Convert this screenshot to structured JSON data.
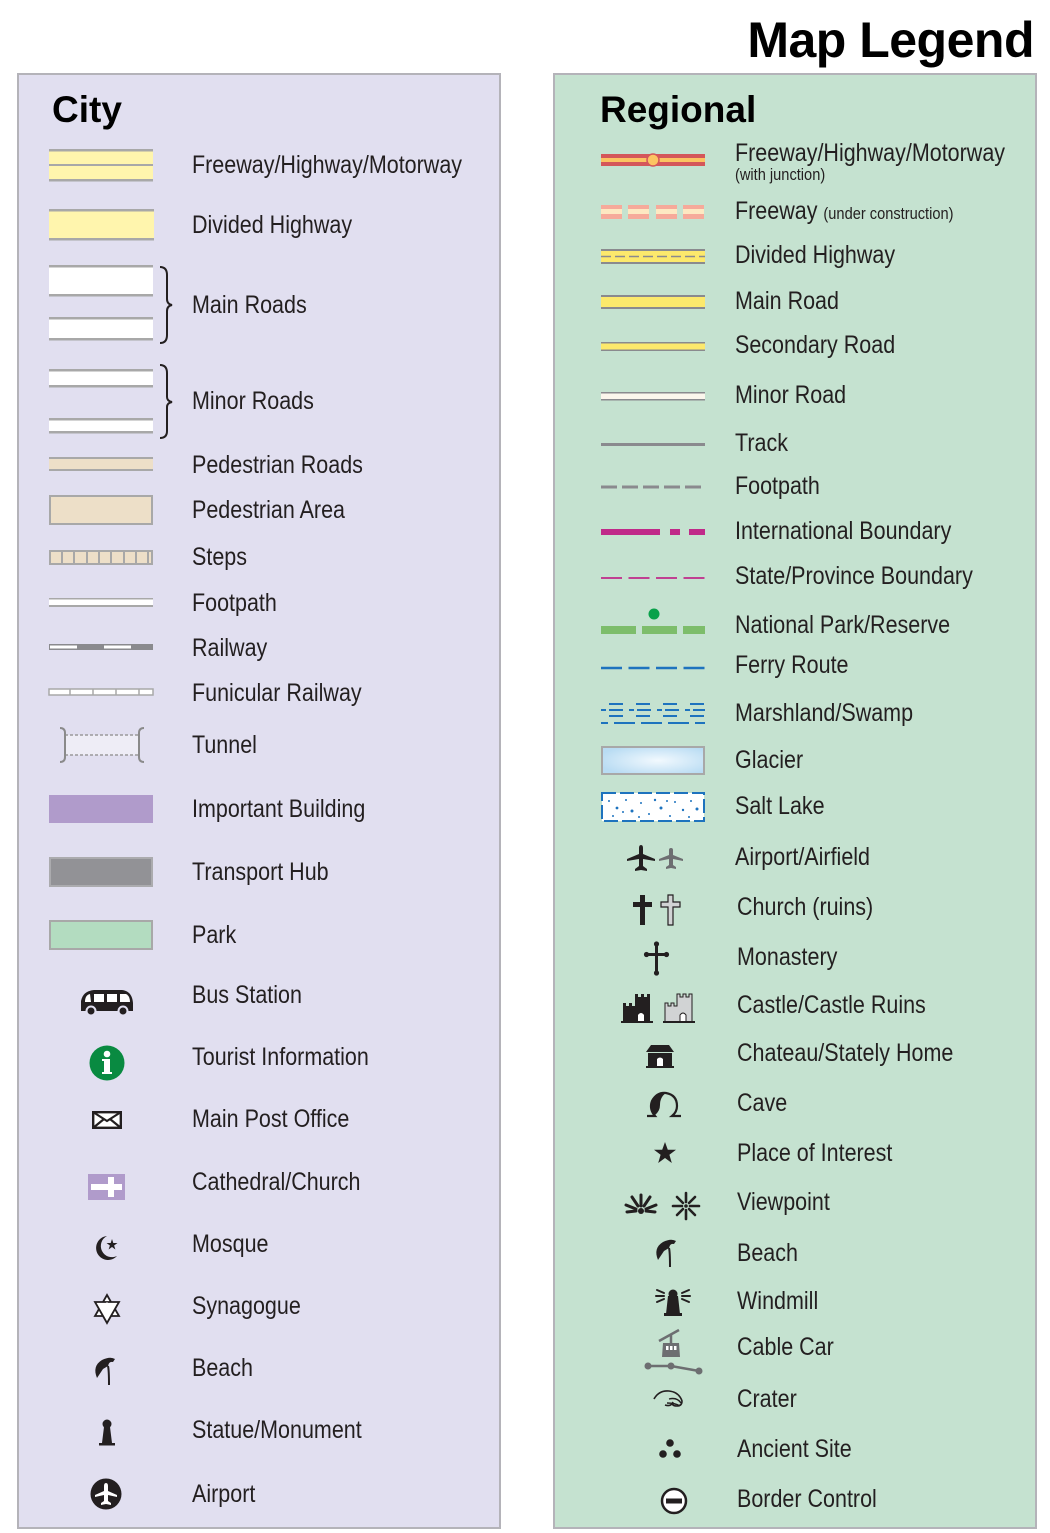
{
  "page_title": "Map Legend",
  "colors": {
    "city_panel_bg": "#e1dff0",
    "regional_panel_bg": "#c5e2d0",
    "panel_border": "#b4b3b9",
    "road_yellow": "#fff5ad",
    "road_grey": "#a8a8a8",
    "pedestrian": "#eddfc8",
    "important_building": "#b09bcb",
    "transport_hub": "#929296",
    "park": "#b3dcc0",
    "tourist_info_green": "#098a41",
    "freeway_red": "#d4575a",
    "freeway_orange": "#fcc462",
    "construction_pink": "#f6aa9a",
    "construction_cream": "#fde8c2",
    "highway_yellow": "#fce96c",
    "boundary_magenta": "#c02a89",
    "national_park_green": "#7dbd6b",
    "national_park_dot": "#09a14a",
    "ferry_blue": "#1e73be",
    "glacier_blue": "#cfe8f8"
  },
  "city": {
    "title": "City",
    "items": [
      {
        "label": "Freeway/Highway/Motorway",
        "symbol": "double-yellow-road"
      },
      {
        "label": "Divided Highway",
        "symbol": "wide-yellow-road"
      },
      {
        "label": "Main Roads",
        "symbol": "white-roads-bracket"
      },
      {
        "label": "Minor Roads",
        "symbol": "thin-white-roads-bracket"
      },
      {
        "label": "Pedestrian Roads",
        "symbol": "tan-road"
      },
      {
        "label": "Pedestrian Area",
        "symbol": "tan-area"
      },
      {
        "label": "Steps",
        "symbol": "steps-line"
      },
      {
        "label": "Footpath",
        "symbol": "white-line"
      },
      {
        "label": "Railway",
        "symbol": "railway-line"
      },
      {
        "label": "Funicular Railway",
        "symbol": "funicular-line"
      },
      {
        "label": "Tunnel",
        "symbol": "tunnel"
      },
      {
        "label": "Important Building",
        "symbol": "purple-area"
      },
      {
        "label": "Transport Hub",
        "symbol": "grey-area"
      },
      {
        "label": "Park",
        "symbol": "green-area"
      },
      {
        "label": "Bus Station",
        "symbol": "bus-icon"
      },
      {
        "label": "Tourist Information",
        "symbol": "info-icon"
      },
      {
        "label": "Main Post Office",
        "symbol": "envelope-icon"
      },
      {
        "label": "Cathedral/Church",
        "symbol": "church-cross-icon"
      },
      {
        "label": "Mosque",
        "symbol": "crescent-star-icon"
      },
      {
        "label": "Synagogue",
        "symbol": "star-of-david-icon"
      },
      {
        "label": "Beach",
        "symbol": "umbrella-icon"
      },
      {
        "label": "Statue/Monument",
        "symbol": "statue-icon"
      },
      {
        "label": "Airport",
        "symbol": "airport-circle-icon"
      }
    ]
  },
  "regional": {
    "title": "Regional",
    "items": [
      {
        "label": "Freeway/Highway/Motorway",
        "note": "(with junction)",
        "symbol": "freeway-junction"
      },
      {
        "label": "Freeway",
        "note": "(under construction)",
        "symbol": "freeway-construction"
      },
      {
        "label": "Divided Highway",
        "symbol": "divided-highway"
      },
      {
        "label": "Main Road",
        "symbol": "main-road"
      },
      {
        "label": "Secondary Road",
        "symbol": "secondary-road"
      },
      {
        "label": "Minor Road",
        "symbol": "minor-road"
      },
      {
        "label": "Track",
        "symbol": "track-line"
      },
      {
        "label": "Footpath",
        "symbol": "footpath-dashed"
      },
      {
        "label": "International Boundary",
        "symbol": "international-boundary"
      },
      {
        "label": "State/Province Boundary",
        "symbol": "state-boundary"
      },
      {
        "label": "National Park/Reserve",
        "symbol": "national-park"
      },
      {
        "label": "Ferry Route",
        "symbol": "ferry-route"
      },
      {
        "label": "Marshland/Swamp",
        "symbol": "marsh"
      },
      {
        "label": "Glacier",
        "symbol": "glacier"
      },
      {
        "label": "Salt Lake",
        "symbol": "salt-lake"
      },
      {
        "label": "Airport/Airfield",
        "symbol": "airplane-icons"
      },
      {
        "label": "Church (ruins)",
        "symbol": "cross-icons"
      },
      {
        "label": "Monastery",
        "symbol": "monastery-cross-icon"
      },
      {
        "label": "Castle/Castle Ruins",
        "symbol": "castle-icons"
      },
      {
        "label": "Chateau/Stately Home",
        "symbol": "chateau-icon"
      },
      {
        "label": "Cave",
        "symbol": "cave-icon"
      },
      {
        "label": "Place of Interest",
        "symbol": "star-icon"
      },
      {
        "label": "Viewpoint",
        "symbol": "viewpoint-icons"
      },
      {
        "label": "Beach",
        "symbol": "umbrella-icon"
      },
      {
        "label": "Windmill",
        "symbol": "windmill-icon"
      },
      {
        "label": "Cable Car",
        "symbol": "cable-car-icon"
      },
      {
        "label": "Crater",
        "symbol": "crater-icon"
      },
      {
        "label": "Ancient Site",
        "symbol": "ancient-site-icon"
      },
      {
        "label": "Border Control",
        "symbol": "border-control-icon"
      }
    ]
  }
}
